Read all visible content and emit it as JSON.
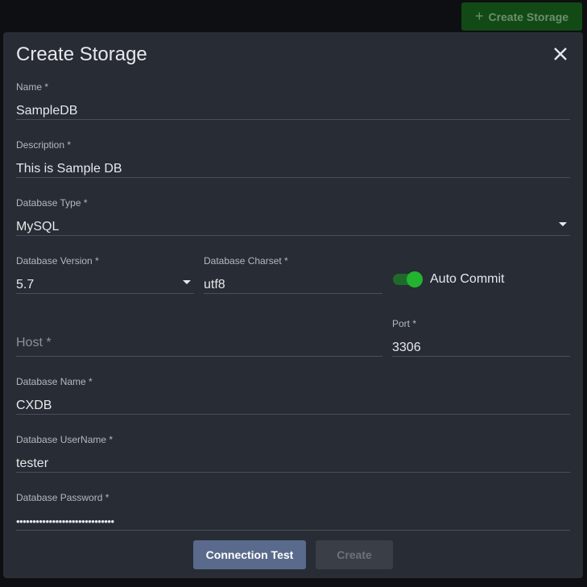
{
  "header": {
    "create_storage_label": "Create Storage"
  },
  "dialog": {
    "title": "Create Storage",
    "fields": {
      "name": {
        "label": "Name *",
        "value": "SampleDB"
      },
      "description": {
        "label": "Description *",
        "value": "This is Sample DB"
      },
      "database_type": {
        "label": "Database Type *",
        "value": "MySQL"
      },
      "database_version": {
        "label": "Database Version *",
        "value": "5.7"
      },
      "database_charset": {
        "label": "Database Charset *",
        "value": "utf8"
      },
      "auto_commit": {
        "label": "Auto Commit",
        "checked": true
      },
      "host": {
        "placeholder": "Host *",
        "value": ""
      },
      "port": {
        "label": "Port *",
        "value": "3306"
      },
      "database_name": {
        "label": "Database Name *",
        "value": "CXDB"
      },
      "database_username": {
        "label": "Database UserName *",
        "value": "tester"
      },
      "database_password": {
        "label": "Database Password *",
        "value": "••••••••••••••••••••••••••••••"
      }
    },
    "buttons": {
      "connection_test": "Connection Test",
      "create": "Create"
    }
  },
  "colors": {
    "accent_green": "#23b42f",
    "primary_button": "#5a6a8c",
    "dialog_background": "#282c34"
  }
}
